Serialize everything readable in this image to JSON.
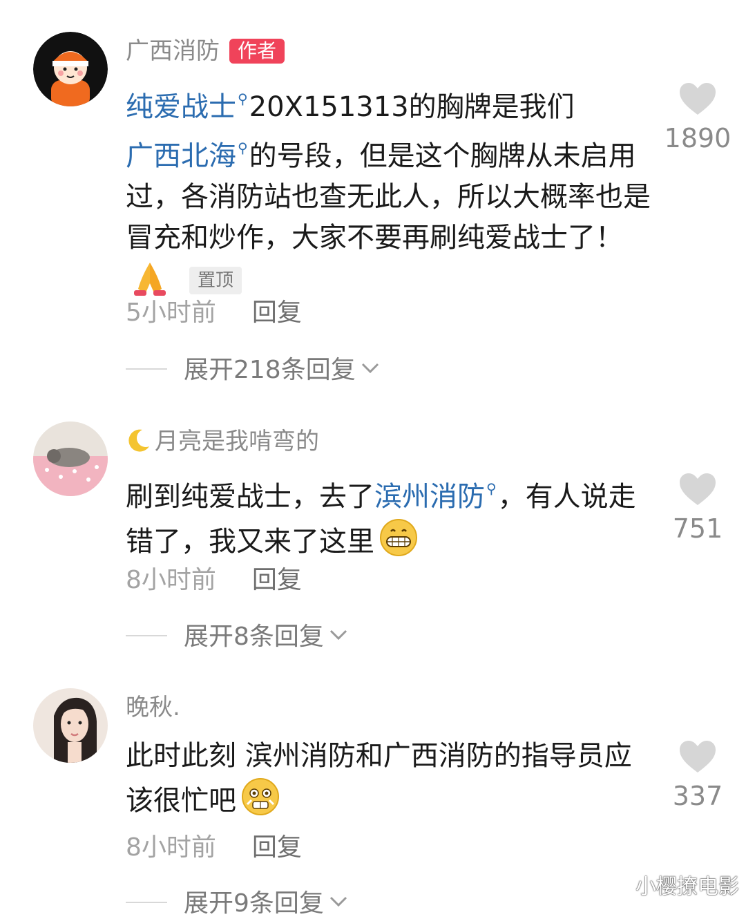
{
  "comments": [
    {
      "username": "广西消防",
      "author_badge": "作者",
      "body": {
        "mention1": "纯爱战士",
        "text1": "20X151313的胸牌是我们",
        "mention2": "广西北海",
        "text2": "的号段，但是这个胸牌从未启用过，各消防站也查无此人，所以大概率也是冒充和炒作，大家不要再刷纯爱战士了！"
      },
      "pin_badge": "置顶",
      "time": "5小时前",
      "reply_label": "回复",
      "expand_label": "展开218条回复",
      "likes": "1890",
      "icons": [
        "firefighter-avatar",
        "prayer-hands-icon",
        "heart-icon",
        "chevron-down-icon"
      ]
    },
    {
      "username": "月亮是我啃弯的",
      "body": {
        "text1": "刷到纯爱战士，去了",
        "mention1": "滨州消防",
        "text2": "，有人说走错了，我又来了这里"
      },
      "time": "8小时前",
      "reply_label": "回复",
      "expand_label": "展开8条回复",
      "likes": "751",
      "icons": [
        "moon-icon",
        "grin-emoji-icon",
        "heart-icon",
        "chevron-down-icon"
      ]
    },
    {
      "username": "晚秋.",
      "body": {
        "text1": "此时此刻 滨州消防和广西消防的指导员应该很忙吧"
      },
      "time": "8小时前",
      "reply_label": "回复",
      "expand_label": "展开9条回复",
      "likes": "337",
      "icons": [
        "woman-avatar",
        "flushed-emoji-icon",
        "heart-icon",
        "chevron-down-icon"
      ]
    }
  ],
  "watermark": "小樱撩电影",
  "colors": {
    "mention": "#2b6cb0",
    "author_badge": "#f0435a",
    "heart": "#d6d6d6",
    "secondary_text": "#8a8a8a"
  }
}
